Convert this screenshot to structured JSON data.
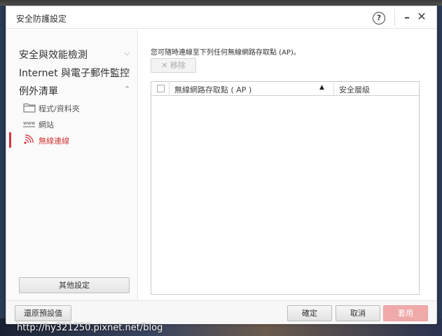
{
  "window": {
    "title": "安全防護設定",
    "help_label": "?",
    "minimize_label": "–",
    "close_label": "✕"
  },
  "sidebar": {
    "items": [
      {
        "label": "安全與效能檢測",
        "chevron": "⌵"
      },
      {
        "label": "Internet 與電子郵件監控",
        "chevron": "⌵"
      },
      {
        "label": "例外清單",
        "chevron": "⌃"
      }
    ],
    "sub_items": [
      {
        "label": "程式/資料夾",
        "icon": "folder-icon"
      },
      {
        "label": "網站",
        "icon": "www-icon",
        "icon_text": "www"
      },
      {
        "label": "無線連線",
        "icon": "wifi-icon",
        "active": true
      }
    ],
    "other_settings_label": "其他設定"
  },
  "content": {
    "description": "您可隨時連線至下列任何無線網路存取點 (AP)。",
    "remove_label": "✕ 移除",
    "table": {
      "columns": [
        "無線網路存取點 ( AP )",
        "安全層級"
      ],
      "sort_indicator": "▲",
      "rows": []
    }
  },
  "footer": {
    "restore_label": "還原預設值",
    "ok_label": "確定",
    "cancel_label": "取消",
    "apply_label": "套用"
  },
  "watermark": "http://hy321250.pixnet.net/blog",
  "colors": {
    "accent": "#d4343c",
    "apply_disabled": "#f0a9a9"
  }
}
